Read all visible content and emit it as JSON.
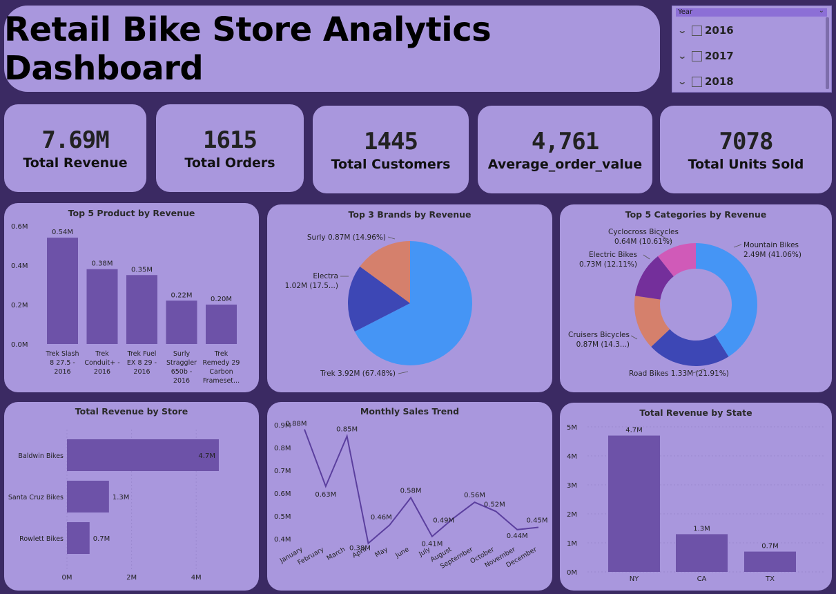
{
  "title": "Retail Bike Store Analytics Dashboard",
  "slicer": {
    "header": "Year",
    "items": [
      "2016",
      "2017",
      "2018"
    ]
  },
  "kpis": [
    {
      "value": "7.69M",
      "label": "Total Revenue"
    },
    {
      "value": "1615",
      "label": "Total Orders"
    },
    {
      "value": "1445",
      "label": "Total Customers"
    },
    {
      "value": "4,761",
      "label": "Average_order_value"
    },
    {
      "value": "7078",
      "label": "Total Units Sold"
    }
  ],
  "colors": {
    "background": "#3b2a63",
    "card": "#a997dd",
    "bar": "#6d52a8",
    "line": "#5b3f9e"
  },
  "chart_data": [
    {
      "type": "bar",
      "title": "Top 5 Product by Revenue",
      "categories": [
        [
          "Trek Slash",
          "8 27.5 -",
          "2016"
        ],
        [
          "Trek",
          "Conduit+ -",
          "2016"
        ],
        [
          "Trek Fuel",
          "EX 8 29 -",
          "2016"
        ],
        [
          "Surly",
          "Straggler",
          "650b -",
          "2016"
        ],
        [
          "Trek",
          "Remedy 29",
          "Carbon",
          "Frameset..."
        ]
      ],
      "values": [
        0.54,
        0.38,
        0.35,
        0.22,
        0.2
      ],
      "data_labels": [
        "0.54M",
        "0.38M",
        "0.35M",
        "0.22M",
        "0.20M"
      ],
      "y_ticks": [
        "0.0M",
        "0.2M",
        "0.4M",
        "0.6M"
      ],
      "ylim": [
        0,
        0.6
      ]
    },
    {
      "type": "pie",
      "title": "Top 3 Brands by Revenue",
      "slices": [
        {
          "name": "Trek",
          "value": 67.48,
          "label": "Trek 3.92M (67.48%)",
          "color": "#4595f5"
        },
        {
          "name": "Electra",
          "value": 17.56,
          "label_lines": [
            "Electra",
            "1.02M (17.5...)"
          ],
          "color": "#3d47b5"
        },
        {
          "name": "Surly",
          "value": 14.96,
          "label": "Surly 0.87M (14.96%)",
          "color": "#d5806c"
        }
      ]
    },
    {
      "type": "pie",
      "title": "Top 5 Categories by Revenue",
      "slices": [
        {
          "name": "Mountain Bikes",
          "value": 41.06,
          "label_lines": [
            "Mountain Bikes",
            "2.49M (41.06%)"
          ],
          "color": "#4595f5"
        },
        {
          "name": "Road Bikes",
          "value": 21.91,
          "label": "Road Bikes 1.33M (21.91%)",
          "color": "#3d47b5"
        },
        {
          "name": "Cruisers Bicycles",
          "value": 14.31,
          "label_lines": [
            "Cruisers Bicycles",
            "0.87M (14.3...)"
          ],
          "color": "#d5806c"
        },
        {
          "name": "Electric Bikes",
          "value": 12.11,
          "label_lines": [
            "Electric Bikes",
            "0.73M (12.11%)"
          ],
          "color": "#742f9b"
        },
        {
          "name": "Cyclocross Bicycles",
          "value": 10.61,
          "label_lines": [
            "Cyclocross Bicycles",
            "0.64M (10.61%)"
          ],
          "color": "#d05ab8"
        }
      ]
    },
    {
      "type": "bar",
      "orientation": "horizontal",
      "title": "Total Revenue by Store",
      "categories": [
        "Baldwin Bikes",
        "Santa Cruz Bikes",
        "Rowlett Bikes"
      ],
      "values": [
        4.7,
        1.3,
        0.7
      ],
      "data_labels": [
        "4.7M",
        "1.3M",
        "0.7M"
      ],
      "x_ticks": [
        "0M",
        "2M",
        "4M"
      ],
      "xlim": [
        0,
        5
      ]
    },
    {
      "type": "line",
      "title": "Monthly Sales Trend",
      "categories": [
        "January",
        "February",
        "March",
        "April",
        "May",
        "June",
        "July",
        "August",
        "September",
        "October",
        "November",
        "December"
      ],
      "values": [
        0.88,
        0.63,
        0.85,
        0.38,
        0.46,
        0.58,
        0.41,
        0.49,
        0.56,
        0.52,
        0.44,
        0.45
      ],
      "data_labels": [
        "0.88M",
        "0.63M",
        "0.85M",
        "0.38M",
        "0.46M",
        "0.58M",
        "0.41M",
        "0.49M",
        "0.56M",
        "0.52M",
        "0.44M",
        "0.45M"
      ],
      "y_ticks": [
        "0.4M",
        "0.5M",
        "0.6M",
        "0.7M",
        "0.8M",
        "0.9M"
      ],
      "ylim": [
        0.4,
        0.9
      ]
    },
    {
      "type": "bar",
      "title": "Total Revenue by State",
      "categories": [
        "NY",
        "CA",
        "TX"
      ],
      "values": [
        4.7,
        1.3,
        0.7
      ],
      "data_labels": [
        "4.7M",
        "1.3M",
        "0.7M"
      ],
      "y_ticks": [
        "0M",
        "1M",
        "2M",
        "3M",
        "4M",
        "5M"
      ],
      "ylim": [
        0,
        5
      ]
    }
  ]
}
